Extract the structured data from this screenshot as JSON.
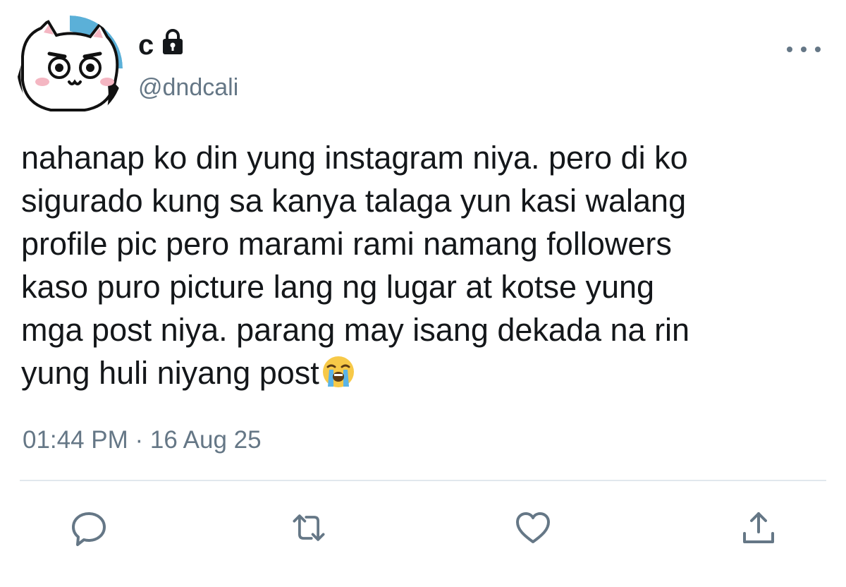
{
  "tweet": {
    "display_name": "c",
    "handle": "@dndcali",
    "text_lines": [
      "nahanap ko din yung instagram niya. pero di ko",
      "sigurado kung sa kanya talaga yun kasi walang",
      "profile pic pero marami rami namang followers",
      "kaso puro picture lang ng lugar at kotse yung",
      "mga post niya. parang may isang dekada na rin",
      "yung huli niyang post"
    ],
    "timestamp": "01:44 PM · 16 Aug 25"
  },
  "icons": {
    "account": "lock-icon",
    "emoji": "loudly-crying-face-emoji",
    "more": "more-icon",
    "reply": "reply-icon",
    "retweet": "retweet-icon",
    "like": "like-icon",
    "share": "share-icon"
  },
  "colors": {
    "text": "#14171a",
    "secondary": "#657786",
    "divider": "#e1e8ed",
    "avatar_ring": "#5bb0d8"
  }
}
